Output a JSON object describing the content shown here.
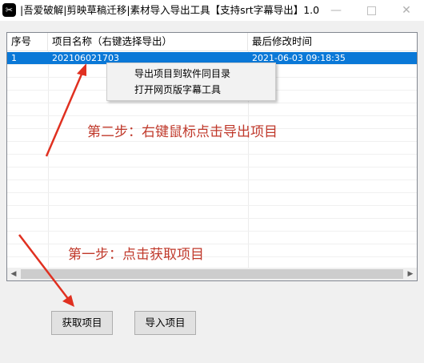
{
  "window": {
    "icon_glyph": "✂",
    "title": "|吾爱破解|剪映草稿迁移|素材导入导出工具【支持srt字幕导出】1.0 ...",
    "minimize": "—",
    "close": "✕"
  },
  "table": {
    "columns": [
      "序号",
      "项目名称（右键选择导出）",
      "最后修改时间"
    ],
    "rows": [
      {
        "index": "1",
        "name": "202106021703",
        "modified": "2021-06-03 09:18:35",
        "selected": true
      }
    ]
  },
  "context_menu": {
    "items": [
      "导出项目到软件同目录",
      "打开网页版字幕工具"
    ]
  },
  "annotations": {
    "step2": "第二步：右键鼠标点击导出项目",
    "step1": "第一步：点击获取项目",
    "color": "#c0392b"
  },
  "buttons": {
    "fetch": "获取项目",
    "import": "导入项目"
  },
  "colors": {
    "selection": "#0a78d7"
  }
}
